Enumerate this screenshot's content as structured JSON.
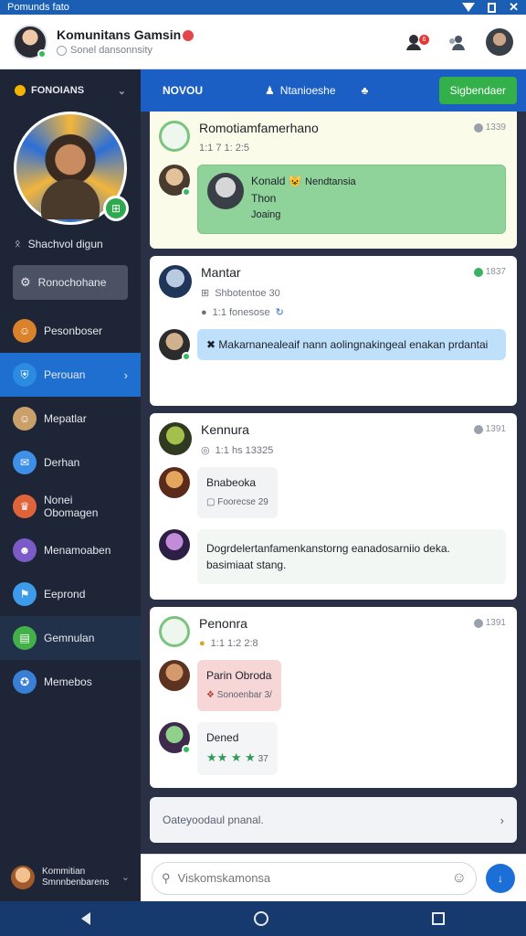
{
  "status_bar": {
    "carrier": "Pomunds fato"
  },
  "header": {
    "title": "Komunitans Gamsin",
    "subtitle": "Sonel dansonnsity",
    "notif_count": "6"
  },
  "sidebar": {
    "section_title": "FONOIANS",
    "user_line": "Shachvol digun",
    "active_box": "Ronochohane",
    "items": [
      {
        "label": "Pesonboser",
        "color": "#d9822b",
        "icon": "face-icon"
      },
      {
        "label": "Perouan",
        "color": "#2b8be0",
        "icon": "shield-icon",
        "current": true
      },
      {
        "label": "Mepatlar",
        "color": "#c9a06a",
        "icon": "face-icon"
      },
      {
        "label": "Derhan",
        "color": "#3e8fe8",
        "icon": "chat-icon"
      },
      {
        "label": "Nonei Obomagen",
        "color": "#e0643a",
        "icon": "trophy-icon"
      },
      {
        "label": "Menamoaben",
        "color": "#7a5bc8",
        "icon": "mask-icon"
      },
      {
        "label": "Eeprond",
        "color": "#3d9be9",
        "icon": "flag-icon"
      },
      {
        "label": "Gemnulan",
        "color": "#43b04a",
        "icon": "gamepad-icon"
      },
      {
        "label": "Memebos",
        "color": "#3a7fd6",
        "icon": "controller-icon"
      }
    ],
    "footer_line1": "Kommitian",
    "footer_line2": "Smnnbenbarens"
  },
  "topbar": {
    "tabs": [
      "NOVOU",
      "Ntanioeshe"
    ],
    "cta": "Sigbendaer"
  },
  "feed": {
    "cards": [
      {
        "title": "Romotiamfamerhano",
        "meta": "1:1 7 1: 2:5",
        "timestamp": "1339",
        "message_name": "Konald",
        "message_tag": "Nendtansia",
        "message_line2": "Thon",
        "message_line3": "Joaing"
      },
      {
        "title": "Mantar",
        "meta": "Shbotentoe 30",
        "timestamp": "1837",
        "stats": "1:1   fonesose",
        "message": "Makarnanealeaif nann aolingnakingeal enakan prdantai"
      },
      {
        "title": "Kennura",
        "meta": "1:1 hs   13325",
        "timestamp": "1391",
        "reply_name": "Bnabeoka",
        "reply_sub": "Foorecse 29",
        "message": "Dogrdelertanfamenkanstorng eanadosarniio deka. basimiaat stang."
      },
      {
        "title": "Penonra",
        "meta": "1:1  1:2 2:8",
        "timestamp": "1391",
        "reply_name": "Parin Obroda",
        "reply_sub": "Sonoenbar 3/",
        "reply2_name": "Dened",
        "reply2_sub": "37"
      }
    ],
    "input_hint": "Oateyoodaul pnanal."
  },
  "composer": {
    "placeholder": "Viskomskamonsa"
  },
  "colors": {
    "accent": "#1c5fc4",
    "cta": "#34b04b",
    "sidebar": "#1e2536"
  }
}
